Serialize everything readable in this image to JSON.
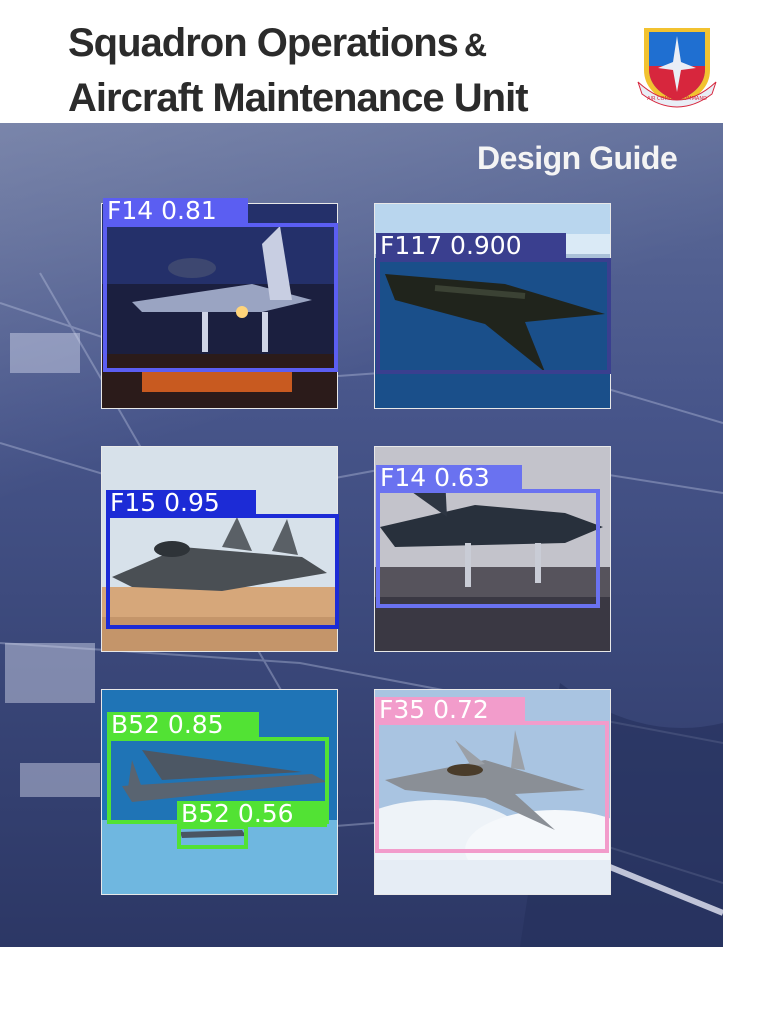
{
  "title": {
    "line1": "Squadron Operations",
    "amp": "&",
    "line2": "Aircraft Maintenance Unit"
  },
  "subtitle": "Design Guide",
  "emblem": {
    "name": "air-combat-command-emblem",
    "text": "AIR COMBAT COMMAND",
    "colors": {
      "shield": "#1f6fd1",
      "bottom": "#d7263d",
      "rim": "#f2c230"
    }
  },
  "detections": [
    {
      "label": "F14 0.81",
      "color": "#5b5ef2"
    },
    {
      "label": "F117 0.900",
      "color": "#3a3f8f"
    },
    {
      "label": "F15 0.95",
      "color": "#1c2bd6"
    },
    {
      "label": "F14 0.63",
      "color": "#6a72f0"
    },
    {
      "label": "B52 0.85",
      "color": "#52e234"
    },
    {
      "label": "B52 0.56",
      "color": "#52e234"
    },
    {
      "label": "F35 0.72",
      "color": "#f29ccb"
    }
  ]
}
